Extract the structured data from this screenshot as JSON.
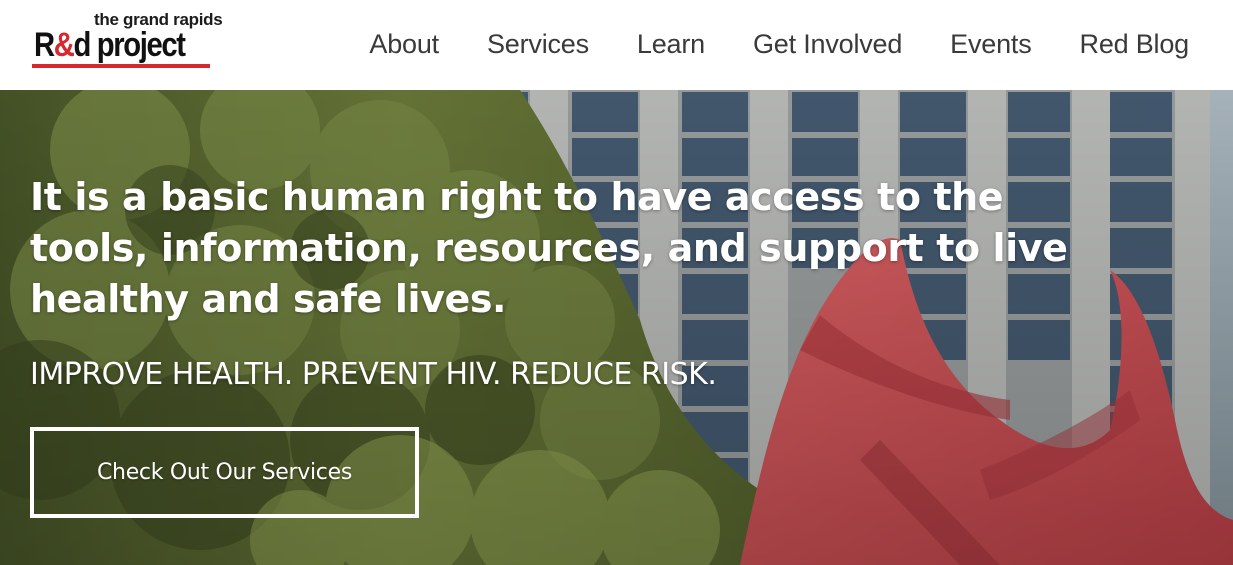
{
  "logo": {
    "top_text": "the grand rapids",
    "main_prefix": "R",
    "ribbon": "&",
    "main_suffix": "d project"
  },
  "nav": {
    "items": [
      {
        "label": "About"
      },
      {
        "label": "Services"
      },
      {
        "label": "Learn"
      },
      {
        "label": "Get Involved"
      },
      {
        "label": "Events"
      },
      {
        "label": "Red Blog"
      }
    ]
  },
  "hero": {
    "headline": "It is a basic human right to have access to the tools, information, resources, and support to live healthy and safe lives.",
    "tagline": "IMPROVE HEALTH. PREVENT HIV. REDUCE RISK.",
    "cta_label": "Check Out Our Services"
  },
  "colors": {
    "brand_red": "#d7282f",
    "nav_text": "#3a3a3a",
    "hero_text": "#ffffff"
  }
}
